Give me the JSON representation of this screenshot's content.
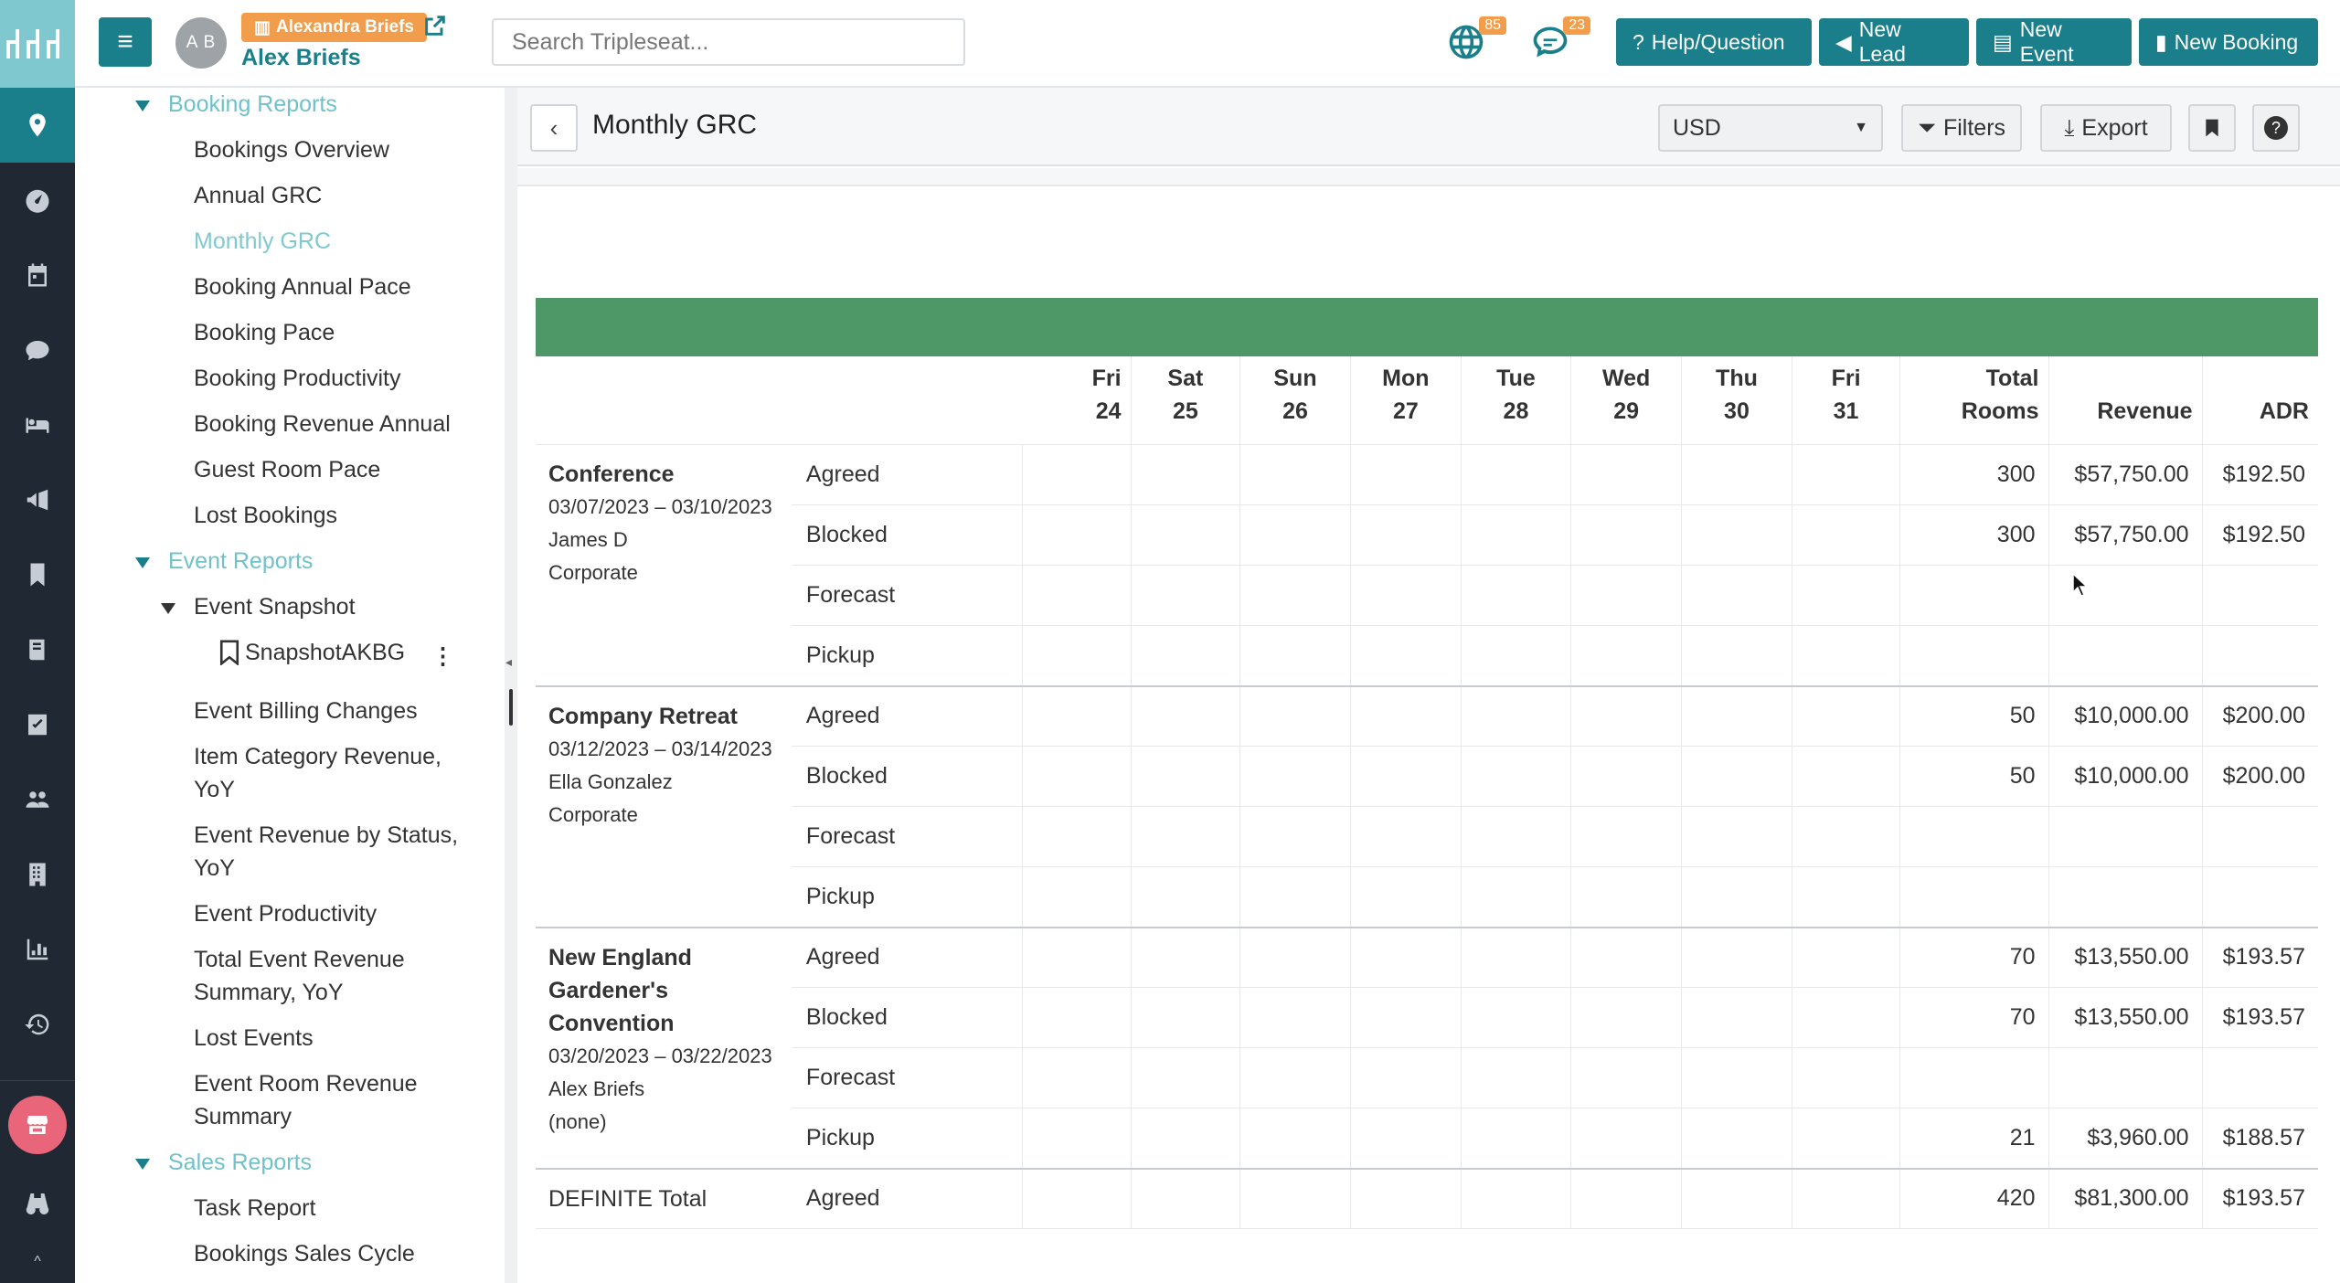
{
  "app": {
    "location_badge": "Alexandra Briefs",
    "user_name": "Alex Briefs",
    "avatar_initials": "A B",
    "search_placeholder": "Search Tripleseat...",
    "notifications": {
      "globe_count": "85",
      "chat_count": "23"
    },
    "buttons": {
      "help": "Help/Question",
      "new_lead": "New Lead",
      "new_event": "New Event",
      "new_booking": "New Booking"
    },
    "accent_color": "#1b7f8b",
    "badge_color": "#f29d4b"
  },
  "rail_icons": [
    "location-icon",
    "dashboard-icon",
    "calendar-icon",
    "chat-icon",
    "bed-icon",
    "megaphone-icon",
    "bookmark-icon",
    "book-icon",
    "checklist-icon",
    "users-icon",
    "building-icon",
    "chart-icon",
    "history-icon",
    "storefront-icon",
    "binoculars-icon"
  ],
  "sidebar": {
    "booking_reports": {
      "title": "Booking Reports",
      "items": [
        "Bookings Overview",
        "Annual GRC",
        "Monthly GRC",
        "Booking Annual Pace",
        "Booking Pace",
        "Booking Productivity",
        "Booking Revenue Annual",
        "Guest Room Pace",
        "Lost Bookings"
      ]
    },
    "event_reports": {
      "title": "Event Reports",
      "snapshot": "Event Snapshot",
      "snapshot_saved": "SnapshotAKBG",
      "items": [
        "Event Billing Changes",
        "Item Category Revenue,",
        "YoY",
        "Event Revenue by Status,",
        "YoY",
        "Event Productivity",
        "Total Event Revenue",
        "Summary, YoY",
        "Lost Events",
        "Event Room Revenue",
        "Summary"
      ]
    },
    "sales_reports": {
      "title": "Sales Reports",
      "items": [
        "Task Report",
        "Bookings Sales Cycle"
      ]
    }
  },
  "report": {
    "title": "Monthly GRC",
    "currency": "USD",
    "filters_label": "Filters",
    "export_label": "Export",
    "columns": {
      "days": [
        {
          "dow": "Fri",
          "day": "24"
        },
        {
          "dow": "Sat",
          "day": "25"
        },
        {
          "dow": "Sun",
          "day": "26"
        },
        {
          "dow": "Mon",
          "day": "27"
        },
        {
          "dow": "Tue",
          "day": "28"
        },
        {
          "dow": "Wed",
          "day": "29"
        },
        {
          "dow": "Thu",
          "day": "30"
        },
        {
          "dow": "Fri",
          "day": "31"
        }
      ],
      "total_rooms_1": "Total",
      "total_rooms_2": "Rooms",
      "revenue": "Revenue",
      "adr": "ADR"
    },
    "groups": [
      {
        "name": "Conference",
        "dates": "03/07/2023 – 03/10/2023",
        "owner": "James D",
        "segment": "Corporate",
        "rows": [
          {
            "type": "Agreed",
            "rooms": "300",
            "revenue": "$57,750.00",
            "adr": "$192.50"
          },
          {
            "type": "Blocked",
            "rooms": "300",
            "revenue": "$57,750.00",
            "adr": "$192.50"
          },
          {
            "type": "Forecast",
            "rooms": "",
            "revenue": "",
            "adr": ""
          },
          {
            "type": "Pickup",
            "rooms": "",
            "revenue": "",
            "adr": ""
          }
        ]
      },
      {
        "name": "Company Retreat",
        "dates": "03/12/2023 – 03/14/2023",
        "owner": "Ella Gonzalez",
        "segment": "Corporate",
        "rows": [
          {
            "type": "Agreed",
            "rooms": "50",
            "revenue": "$10,000.00",
            "adr": "$200.00"
          },
          {
            "type": "Blocked",
            "rooms": "50",
            "revenue": "$10,000.00",
            "adr": "$200.00"
          },
          {
            "type": "Forecast",
            "rooms": "",
            "revenue": "",
            "adr": ""
          },
          {
            "type": "Pickup",
            "rooms": "",
            "revenue": "",
            "adr": ""
          }
        ]
      },
      {
        "name_lines": [
          "New England",
          "Gardener's",
          "Convention"
        ],
        "dates": "03/20/2023 – 03/22/2023",
        "owner": "Alex Briefs",
        "segment": "(none)",
        "rows": [
          {
            "type": "Agreed",
            "rooms": "70",
            "revenue": "$13,550.00",
            "adr": "$193.57"
          },
          {
            "type": "Blocked",
            "rooms": "70",
            "revenue": "$13,550.00",
            "adr": "$193.57"
          },
          {
            "type": "Forecast",
            "rooms": "",
            "revenue": "",
            "adr": ""
          },
          {
            "type": "Pickup",
            "rooms": "21",
            "revenue": "$3,960.00",
            "adr": "$188.57"
          }
        ]
      }
    ],
    "total": {
      "label": "DEFINITE Total",
      "type": "Agreed",
      "rooms": "420",
      "revenue": "$81,300.00",
      "adr": "$193.57"
    },
    "header_band_color": "#4e9868"
  }
}
